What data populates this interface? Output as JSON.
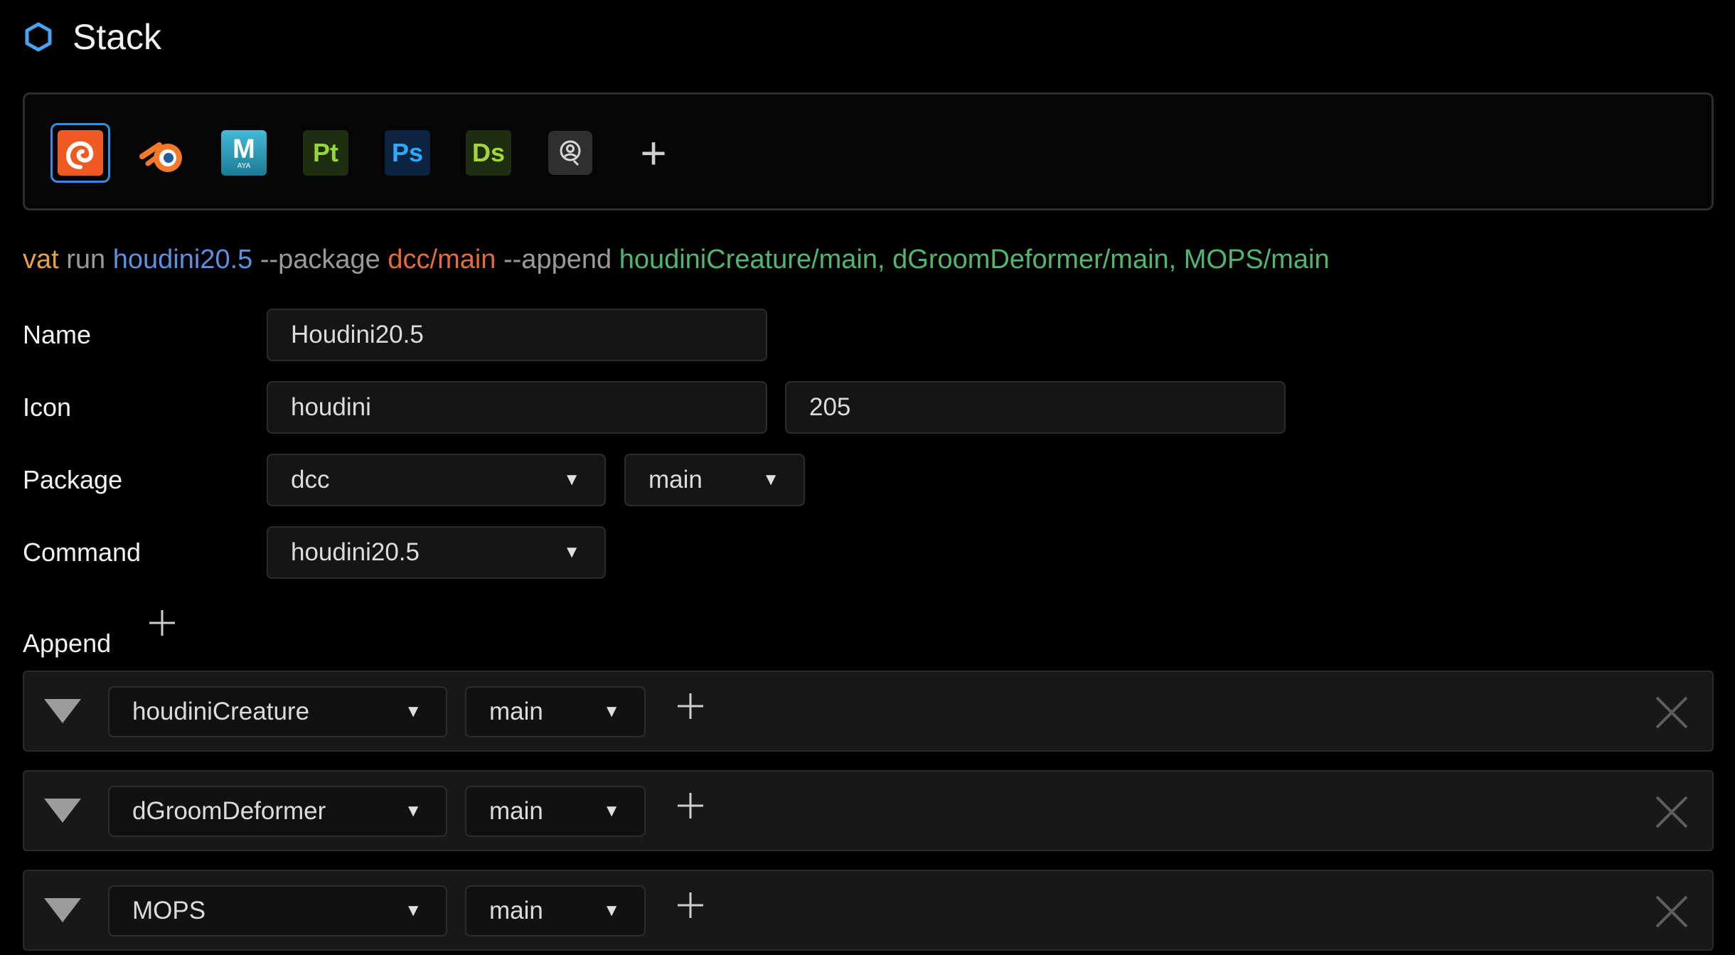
{
  "header": {
    "title": "Stack",
    "icon": "hexagon-icon"
  },
  "toolbar": {
    "apps": [
      {
        "name": "houdini",
        "label": "",
        "selected": true
      },
      {
        "name": "blender",
        "label": ""
      },
      {
        "name": "maya",
        "label": "M",
        "sublabel": "AYA"
      },
      {
        "name": "painter",
        "label": "Pt"
      },
      {
        "name": "photoshop",
        "label": "Ps"
      },
      {
        "name": "designer",
        "label": "Ds"
      },
      {
        "name": "generic-app",
        "label": ""
      }
    ],
    "add_label": "+"
  },
  "command_line": {
    "vat": "vat",
    "run": "run",
    "app": "houdini20.5",
    "package_flag": "--package",
    "package": "dcc/main",
    "append_flag": "--append",
    "appends": "houdiniCreature/main, dGroomDeformer/main, MOPS/main"
  },
  "form": {
    "name_label": "Name",
    "name_value": "Houdini20.5",
    "icon_label": "Icon",
    "icon_value": "houdini",
    "icon_number": "205",
    "package_label": "Package",
    "package_value": "dcc",
    "package_version": "main",
    "command_label": "Command",
    "command_value": "houdini20.5"
  },
  "append": {
    "label": "Append",
    "rows": [
      {
        "package": "houdiniCreature",
        "version": "main"
      },
      {
        "package": "dGroomDeformer",
        "version": "main"
      },
      {
        "package": "MOPS",
        "version": "main"
      }
    ]
  },
  "colors": {
    "accent": "#2f8fe8",
    "background": "#000000",
    "field": "#151515"
  }
}
